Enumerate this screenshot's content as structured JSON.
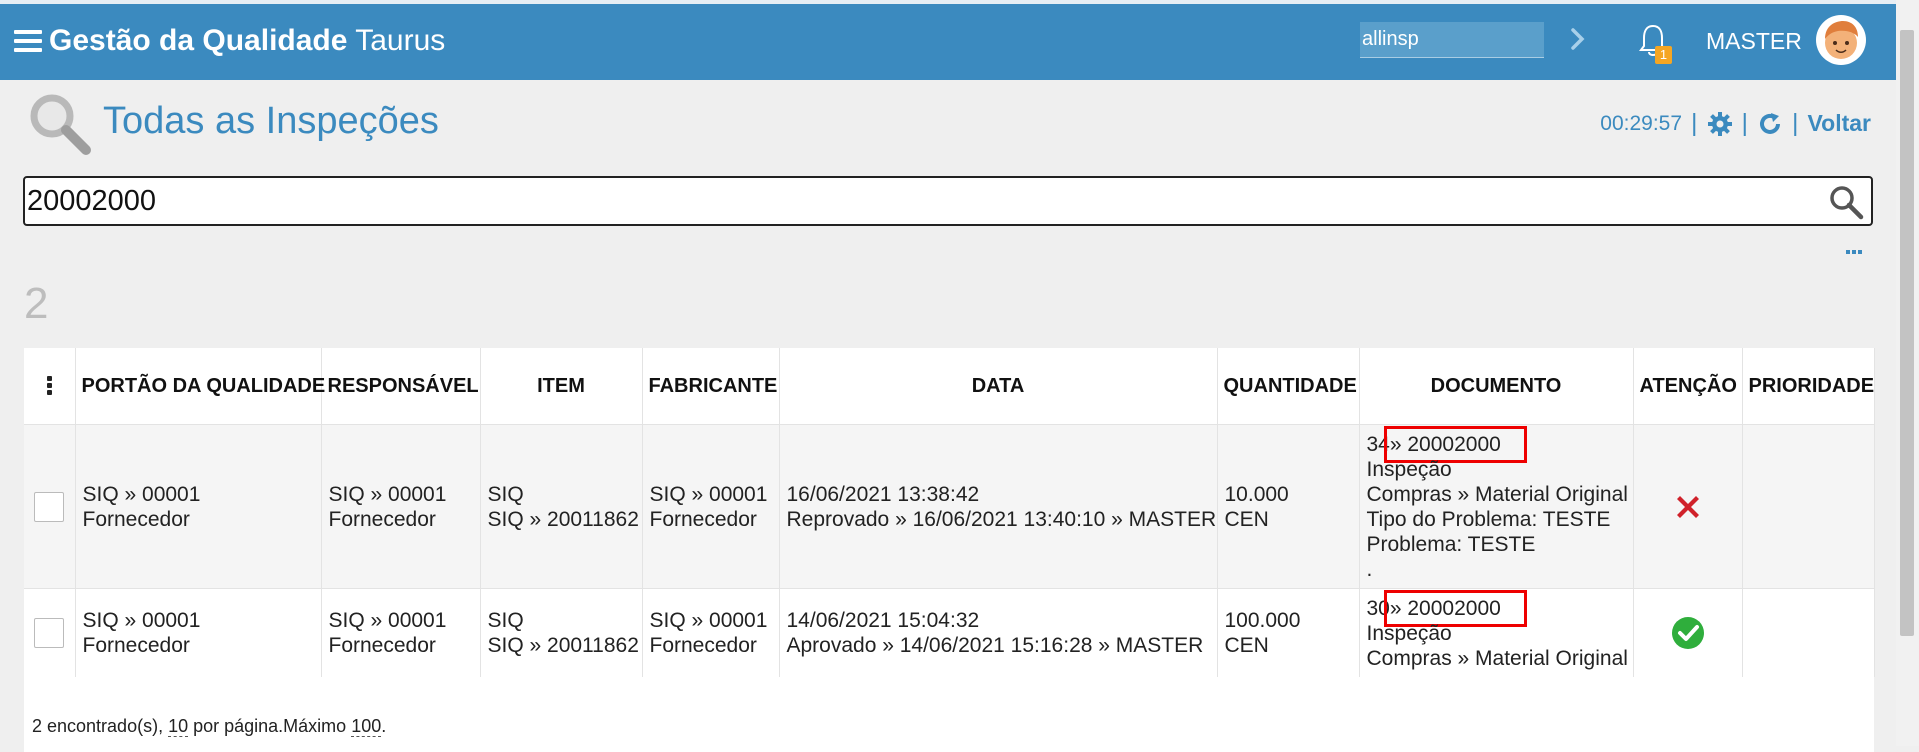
{
  "header": {
    "app_title_bold": "Gestão da Qualidade",
    "app_title_rest": "Taurus",
    "context_value": "allinsp",
    "notification_count": "1",
    "username": "MASTER"
  },
  "page": {
    "title": "Todas as Inspeções",
    "timer": "00:29:57",
    "back_label": "Voltar",
    "search_value": "20002000",
    "result_count": "2"
  },
  "table": {
    "headers": {
      "gate": "PORTÃO DA QUALIDADE",
      "responsible": "RESPONSÁVEL",
      "item": "ITEM",
      "manufacturer": "FABRICANTE",
      "date": "DATA",
      "quantity": "QUANTIDADE",
      "document": "DOCUMENTO",
      "attention": "ATENÇÃO",
      "priority": "PRIORIDADE"
    },
    "rows": [
      {
        "gate_1": "SIQ » 00001",
        "gate_2": "Fornecedor",
        "resp_1": "SIQ » 00001",
        "resp_2": "Fornecedor",
        "item_1": "SIQ",
        "item_2": "SIQ » 20011862",
        "manu_1": "SIQ » 00001",
        "manu_2": "Fornecedor",
        "date_1": "16/06/2021 13:38:42",
        "date_2": "Reprovado » 16/06/2021 13:40:10 » MASTER",
        "qty_1": "10.000",
        "qty_2": "CEN",
        "doc_prefix": "34",
        "doc_number": "» 20002000",
        "doc_2": "Inspeção",
        "doc_3": "Compras » Material Original",
        "doc_4": "Tipo do Problema: TESTE",
        "doc_5": "Problema: TESTE",
        "doc_6": ".",
        "attention": "x-icon",
        "priority": ""
      },
      {
        "gate_1": "SIQ » 00001",
        "gate_2": "Fornecedor",
        "resp_1": "SIQ » 00001",
        "resp_2": "Fornecedor",
        "item_1": "SIQ",
        "item_2": "SIQ » 20011862",
        "manu_1": "SIQ » 00001",
        "manu_2": "Fornecedor",
        "date_1": "14/06/2021 15:04:32",
        "date_2": "Aprovado » 14/06/2021 15:16:28 » MASTER",
        "qty_1": "100.000",
        "qty_2": "CEN",
        "doc_prefix": "30",
        "doc_number": "» 20002000",
        "doc_2": "Inspeção",
        "doc_3": "Compras » Material Original",
        "attention": "check-icon",
        "priority": ""
      }
    ]
  },
  "footer": {
    "found_text": "2 encontrado(s), ",
    "per_page_num": "10",
    "per_page_text": " por página.Máximo ",
    "max_num": "100",
    "end": "."
  },
  "colors": {
    "header_bg": "#3b8abf",
    "accent": "#3b8abf",
    "highlight_box": "#e00000",
    "reject": "#d0212a",
    "approve": "#2fae3c",
    "badge": "#f5a623"
  }
}
